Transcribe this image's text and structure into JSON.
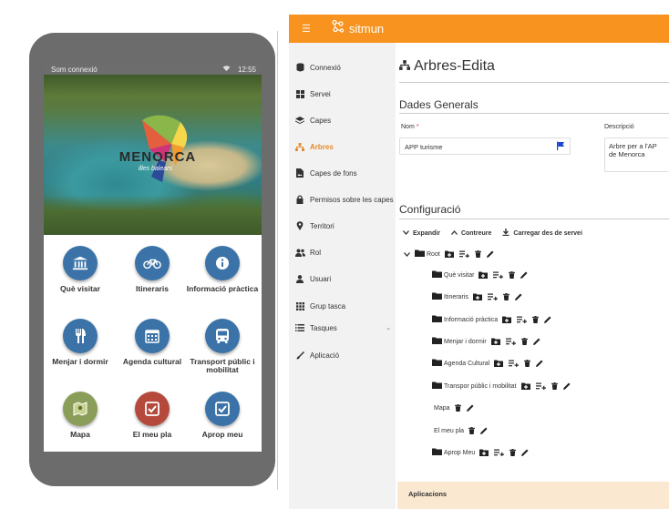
{
  "phone": {
    "status_left": "Som connexió",
    "status_time": "12:55",
    "logo_title": "MENORCA",
    "logo_sub": "illes balears",
    "tiles": [
      {
        "label": "Què visitar",
        "color": "#3b73a8",
        "icon": "museum-icon"
      },
      {
        "label": "Itineraris",
        "color": "#3b73a8",
        "icon": "bicycle-icon"
      },
      {
        "label": "Informació pràctica",
        "color": "#3b73a8",
        "icon": "info-icon"
      },
      {
        "label": "Menjar i dormir",
        "color": "#3b73a8",
        "icon": "restaurant-icon"
      },
      {
        "label": "Agenda cultural",
        "color": "#3b73a8",
        "icon": "calendar-icon"
      },
      {
        "label": "Transport públic i mobilitat",
        "color": "#3b73a8",
        "icon": "bus-icon"
      },
      {
        "label": "Mapa",
        "color": "#8a9e5a",
        "icon": "map-icon"
      },
      {
        "label": "El meu pla",
        "color": "#b54a3c",
        "icon": "checkbox-icon"
      },
      {
        "label": "Aprop meu",
        "color": "#3b73a8",
        "icon": "checkbox-icon"
      }
    ]
  },
  "app": {
    "brand": "sitmun",
    "accent": "#f7931e",
    "sidebar": [
      {
        "label": "Connexió",
        "icon": "database-icon"
      },
      {
        "label": "Servei",
        "icon": "grid-icon"
      },
      {
        "label": "Capes",
        "icon": "layers-icon"
      },
      {
        "label": "Arbres",
        "icon": "tree-icon",
        "active": true
      },
      {
        "label": "Capes de fons",
        "icon": "image-file-icon"
      },
      {
        "label": "Permisos sobre les capes",
        "icon": "lock-icon"
      },
      {
        "label": "Territori",
        "icon": "pin-icon"
      },
      {
        "label": "Rol",
        "icon": "users-icon"
      },
      {
        "label": "Usuari",
        "icon": "user-icon"
      },
      {
        "label": "Grup tasca",
        "icon": "apps-grid-icon"
      },
      {
        "label": "Tasques",
        "icon": "list-icon"
      },
      {
        "label": "Aplicació",
        "icon": "brush-icon"
      }
    ],
    "page_title": "Arbres-Edita",
    "general_section": "Dades Generals",
    "name_label": "Nom",
    "name_required": "*",
    "name_value": "APP turisme",
    "desc_label": "Descripció",
    "desc_value": "Arbre per a l'AP de Menorca",
    "config_section": "Configuració",
    "toolbar": {
      "expand": "Expandir",
      "collapse": "Contreure",
      "load": "Carregar des de servei"
    },
    "tree": [
      {
        "label": "Root",
        "type": "root"
      },
      {
        "label": "Què visitar",
        "type": "folder"
      },
      {
        "label": "Itineraris",
        "type": "folder"
      },
      {
        "label": "Informació pràctica",
        "type": "folder"
      },
      {
        "label": "Menjar i dormir",
        "type": "folder"
      },
      {
        "label": "Agenda Cultural",
        "type": "folder"
      },
      {
        "label": "Transpor públic i mobilitat",
        "type": "folder"
      },
      {
        "label": "Mapa",
        "type": "leaf"
      },
      {
        "label": "El meu pla",
        "type": "leaf"
      },
      {
        "label": "Aprop Meu",
        "type": "folder"
      }
    ],
    "apps_section": "Aplicacions"
  }
}
